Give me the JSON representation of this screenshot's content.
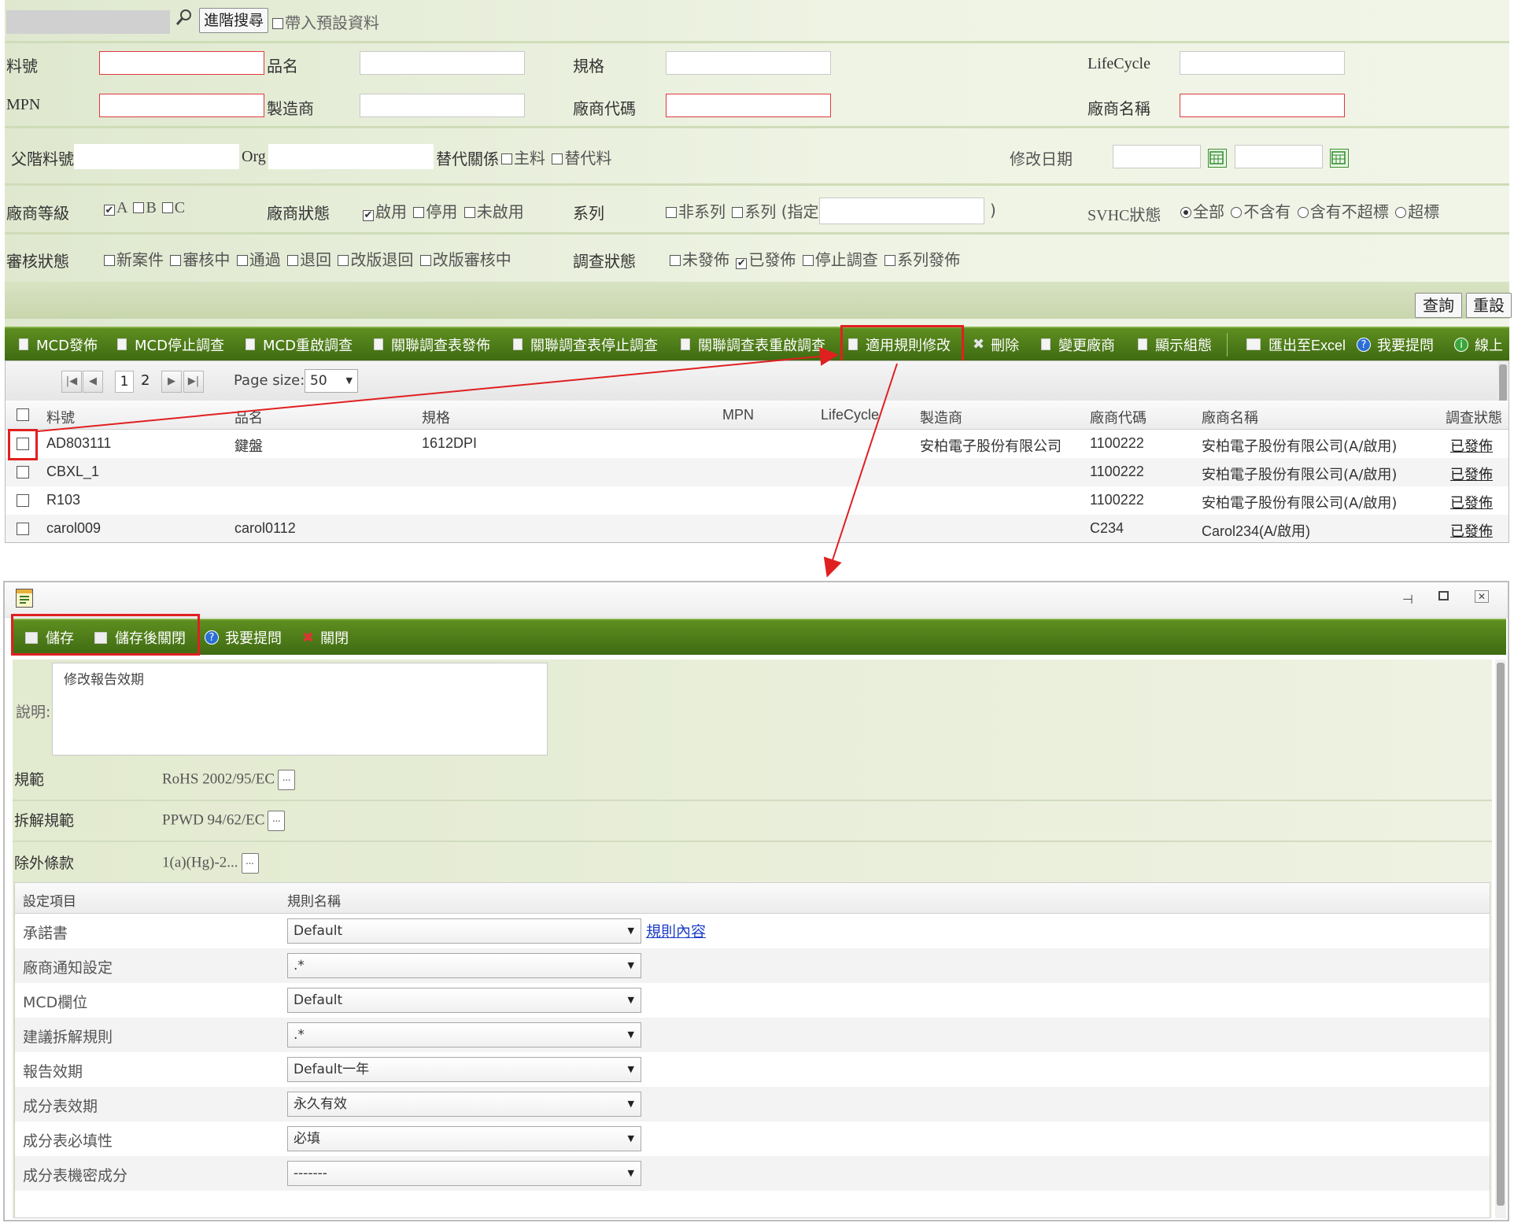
{
  "search": {
    "advanced_button": "進階搜尋",
    "load_defaults_label": "帶入預設資料"
  },
  "filters": {
    "part_no": "料號",
    "product_name": "品名",
    "spec": "規格",
    "lifecycle": "LifeCycle",
    "mpn": "MPN",
    "manufacturer": "製造商",
    "vendor_code": "廠商代碼",
    "vendor_name": "廠商名稱",
    "parent_part": "父階料號",
    "org": "Org",
    "substitute": "替代關係",
    "substitute_main": "主料",
    "substitute_alt": "替代料",
    "modified_date": "修改日期",
    "vendor_grade": "廠商等級",
    "grade_a": "A",
    "grade_b": "B",
    "grade_c": "C",
    "vendor_status": "廠商狀態",
    "status_enabled": "啟用",
    "status_disabled": "停用",
    "status_not_enabled": "未啟用",
    "series": "系列",
    "series_non": "非系列",
    "series_yes": "系列 (指定",
    "series_close": ")",
    "svhc": "SVHC狀態",
    "svhc_all": "全部",
    "svhc_none": "不含有",
    "svhc_under": "含有不超標",
    "svhc_over": "超標",
    "review_status": "審核狀態",
    "review_new": "新案件",
    "review_pending": "審核中",
    "review_pass": "通過",
    "review_return": "退回",
    "review_rev_return": "改版退回",
    "review_rev_pending": "改版審核中",
    "survey_status": "調查狀態",
    "survey_unpublished": "未發佈",
    "survey_published": "已發佈",
    "survey_stopped": "停止調查",
    "survey_series": "系列發佈"
  },
  "actions": {
    "query": "查詢",
    "reset": "重設"
  },
  "toolbar": {
    "mcd_publish": "MCD發佈",
    "mcd_stop": "MCD停止調查",
    "mcd_restart": "MCD重啟調查",
    "rel_publish": "關聯調查表發佈",
    "rel_stop": "關聯調查表停止調查",
    "rel_restart": "關聯調查表重啟調查",
    "rule_edit": "適用規則修改",
    "delete": "刪除",
    "change_vendor": "變更廠商",
    "show_group": "顯示組態",
    "export_excel": "匯出至Excel",
    "ask": "我要提問",
    "online": "線上"
  },
  "pager": {
    "page1": "1",
    "page2": "2",
    "page_size_label": "Page size:",
    "page_size": "50"
  },
  "grid": {
    "headers": [
      "料號",
      "品名",
      "規格",
      "MPN",
      "LifeCycle",
      "製造商",
      "廠商代碼",
      "廠商名稱",
      "調查狀態"
    ],
    "rows": [
      [
        "AD803111",
        "鍵盤",
        "1612DPI",
        "",
        "",
        "安柏電子股份有限公司",
        "1100222",
        "安柏電子股份有限公司(A/啟用)",
        "已發佈"
      ],
      [
        "CBXL_1",
        "",
        "",
        "",
        "",
        "",
        "1100222",
        "安柏電子股份有限公司(A/啟用)",
        "已發佈"
      ],
      [
        "R103",
        "",
        "",
        "",
        "",
        "",
        "1100222",
        "安柏電子股份有限公司(A/啟用)",
        "已發佈"
      ],
      [
        "carol009",
        "carol0112",
        "",
        "",
        "",
        "",
        "C234",
        "Carol234(A/啟用)",
        "已發佈"
      ]
    ]
  },
  "dialog": {
    "toolbar": {
      "save": "儲存",
      "save_close": "儲存後關閉",
      "ask": "我要提問",
      "close": "關閉"
    },
    "desc_label": "說明:",
    "desc_value": "修改報告效期",
    "regulation_label": "規範",
    "regulation_value": "RoHS 2002/95/EC",
    "disassembly_label": "拆解規範",
    "disassembly_value": "PPWD 94/62/EC",
    "exemption_label": "除外條款",
    "exemption_value": "1(a)(Hg)-2...",
    "dots": "...",
    "table_headers": [
      "設定項目",
      "規則名稱"
    ],
    "rule_link": "規則內容",
    "rules": [
      {
        "item": "承諾書",
        "value": "Default"
      },
      {
        "item": "廠商通知設定",
        "value": ".*"
      },
      {
        "item": "MCD欄位",
        "value": "Default"
      },
      {
        "item": "建議拆解規則",
        "value": ".*"
      },
      {
        "item": "報告效期",
        "value": "Default一年"
      },
      {
        "item": "成分表效期",
        "value": "永久有效"
      },
      {
        "item": "成分表必填性",
        "value": "必填"
      },
      {
        "item": "成分表機密成分",
        "value": "-------"
      }
    ]
  }
}
